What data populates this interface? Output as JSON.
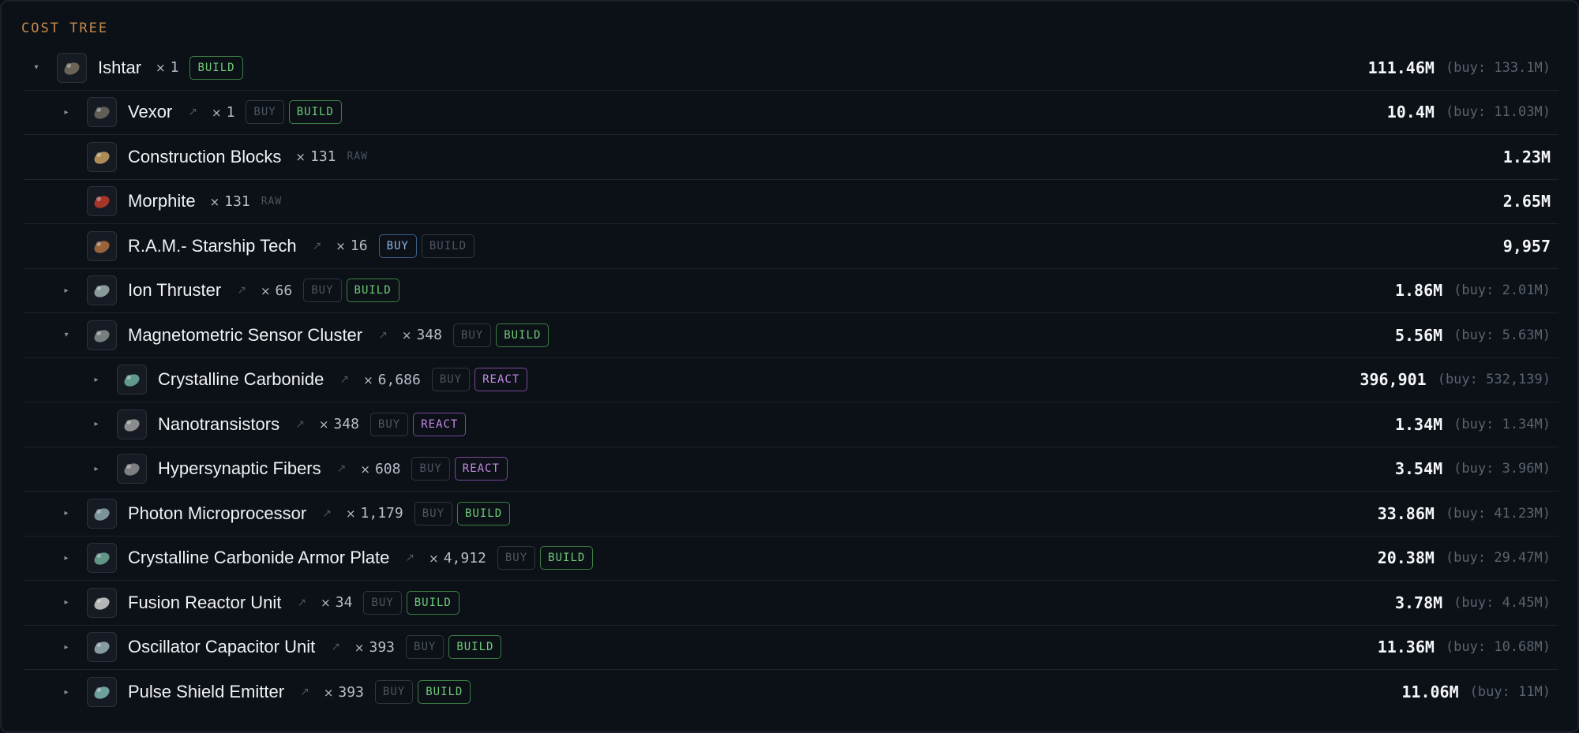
{
  "section_title": "COST TREE",
  "glyphs": {
    "expanded": "▾",
    "collapsed": "▸",
    "link": "↗",
    "times": "×"
  },
  "rows": [
    {
      "name": "Ishtar",
      "qty": "1",
      "toggle": "expanded",
      "depth": 0,
      "link": false,
      "raw": false,
      "buttons": [
        {
          "label": "BUILD",
          "state": "active-build"
        }
      ],
      "cost": "111.46M",
      "buy": "(buy: 133.1M)",
      "icon": "ishtar-icon",
      "icon_color": "#7a7060"
    },
    {
      "name": "Vexor",
      "qty": "1",
      "toggle": "collapsed",
      "depth": 1,
      "link": true,
      "raw": false,
      "buttons": [
        {
          "label": "BUY",
          "state": ""
        },
        {
          "label": "BUILD",
          "state": "active-build"
        }
      ],
      "cost": "10.4M",
      "buy": "(buy: 11.03M)",
      "icon": "vexor-icon",
      "icon_color": "#6d6a60"
    },
    {
      "name": "Construction Blocks",
      "qty": "131",
      "toggle": "none",
      "depth": 1,
      "link": false,
      "raw": true,
      "raw_label": "RAW",
      "buttons": [],
      "cost": "1.23M",
      "buy": "",
      "icon": "construction-blocks-icon",
      "icon_color": "#c8a060"
    },
    {
      "name": "Morphite",
      "qty": "131",
      "toggle": "none",
      "depth": 1,
      "link": false,
      "raw": true,
      "raw_label": "RAW",
      "buttons": [],
      "cost": "2.65M",
      "buy": "",
      "icon": "morphite-icon",
      "icon_color": "#c0392b"
    },
    {
      "name": "R.A.M.- Starship Tech",
      "qty": "16",
      "toggle": "none",
      "depth": 1,
      "link": true,
      "raw": false,
      "buttons": [
        {
          "label": "BUY",
          "state": "active-buy"
        },
        {
          "label": "BUILD",
          "state": ""
        }
      ],
      "cost": "9,957",
      "buy": "",
      "icon": "ram-starship-tech-icon",
      "icon_color": "#b07040"
    },
    {
      "name": "Ion Thruster",
      "qty": "66",
      "toggle": "collapsed",
      "depth": 1,
      "link": true,
      "raw": false,
      "buttons": [
        {
          "label": "BUY",
          "state": ""
        },
        {
          "label": "BUILD",
          "state": "active-build"
        }
      ],
      "cost": "1.86M",
      "buy": "(buy: 2.01M)",
      "icon": "ion-thruster-icon",
      "icon_color": "#9fb0b0"
    },
    {
      "name": "Magnetometric Sensor Cluster",
      "qty": "348",
      "toggle": "expanded",
      "depth": 1,
      "link": true,
      "raw": false,
      "buttons": [
        {
          "label": "BUY",
          "state": ""
        },
        {
          "label": "BUILD",
          "state": "active-build"
        }
      ],
      "cost": "5.56M",
      "buy": "(buy: 5.63M)",
      "icon": "magnetometric-sensor-cluster-icon",
      "icon_color": "#8a9090"
    },
    {
      "name": "Crystalline Carbonide",
      "qty": "6,686",
      "toggle": "collapsed",
      "depth": 2,
      "link": true,
      "raw": false,
      "buttons": [
        {
          "label": "BUY",
          "state": ""
        },
        {
          "label": "REACT",
          "state": "active-react"
        }
      ],
      "cost": "396,901",
      "buy": "(buy: 532,139)",
      "icon": "crystalline-carbonide-icon",
      "icon_color": "#6fb0a0"
    },
    {
      "name": "Nanotransistors",
      "qty": "348",
      "toggle": "collapsed",
      "depth": 2,
      "link": true,
      "raw": false,
      "buttons": [
        {
          "label": "BUY",
          "state": ""
        },
        {
          "label": "REACT",
          "state": "active-react"
        }
      ],
      "cost": "1.34M",
      "buy": "(buy: 1.34M)",
      "icon": "nanotransistors-icon",
      "icon_color": "#a0a0a0"
    },
    {
      "name": "Hypersynaptic Fibers",
      "qty": "608",
      "toggle": "collapsed",
      "depth": 2,
      "link": true,
      "raw": false,
      "buttons": [
        {
          "label": "BUY",
          "state": ""
        },
        {
          "label": "REACT",
          "state": "active-react"
        }
      ],
      "cost": "3.54M",
      "buy": "(buy: 3.96M)",
      "icon": "hypersynaptic-fibers-icon",
      "icon_color": "#909090"
    },
    {
      "name": "Photon Microprocessor",
      "qty": "1,179",
      "toggle": "collapsed",
      "depth": 1,
      "link": true,
      "raw": false,
      "buttons": [
        {
          "label": "BUY",
          "state": ""
        },
        {
          "label": "BUILD",
          "state": "active-build"
        }
      ],
      "cost": "33.86M",
      "buy": "(buy: 41.23M)",
      "icon": "photon-microprocessor-icon",
      "icon_color": "#8fa8b0"
    },
    {
      "name": "Crystalline Carbonide Armor Plate",
      "qty": "4,912",
      "toggle": "collapsed",
      "depth": 1,
      "link": true,
      "raw": false,
      "buttons": [
        {
          "label": "BUY",
          "state": ""
        },
        {
          "label": "BUILD",
          "state": "active-build"
        }
      ],
      "cost": "20.38M",
      "buy": "(buy: 29.47M)",
      "icon": "crystalline-carbonide-armor-plate-icon",
      "icon_color": "#6faa98"
    },
    {
      "name": "Fusion Reactor Unit",
      "qty": "34",
      "toggle": "collapsed",
      "depth": 1,
      "link": true,
      "raw": false,
      "buttons": [
        {
          "label": "BUY",
          "state": ""
        },
        {
          "label": "BUILD",
          "state": "active-build"
        }
      ],
      "cost": "3.78M",
      "buy": "(buy: 4.45M)",
      "icon": "fusion-reactor-unit-icon",
      "icon_color": "#d0d0d0"
    },
    {
      "name": "Oscillator Capacitor Unit",
      "qty": "393",
      "toggle": "collapsed",
      "depth": 1,
      "link": true,
      "raw": false,
      "buttons": [
        {
          "label": "BUY",
          "state": ""
        },
        {
          "label": "BUILD",
          "state": "active-build"
        }
      ],
      "cost": "11.36M",
      "buy": "(buy: 10.68M)",
      "icon": "oscillator-capacitor-unit-icon",
      "icon_color": "#9ab0b8"
    },
    {
      "name": "Pulse Shield Emitter",
      "qty": "393",
      "toggle": "collapsed",
      "depth": 1,
      "link": true,
      "raw": false,
      "buttons": [
        {
          "label": "BUY",
          "state": ""
        },
        {
          "label": "BUILD",
          "state": "active-build"
        }
      ],
      "cost": "11.06M",
      "buy": "(buy: 11M)",
      "icon": "pulse-shield-emitter-icon",
      "icon_color": "#7fb8b0"
    }
  ]
}
